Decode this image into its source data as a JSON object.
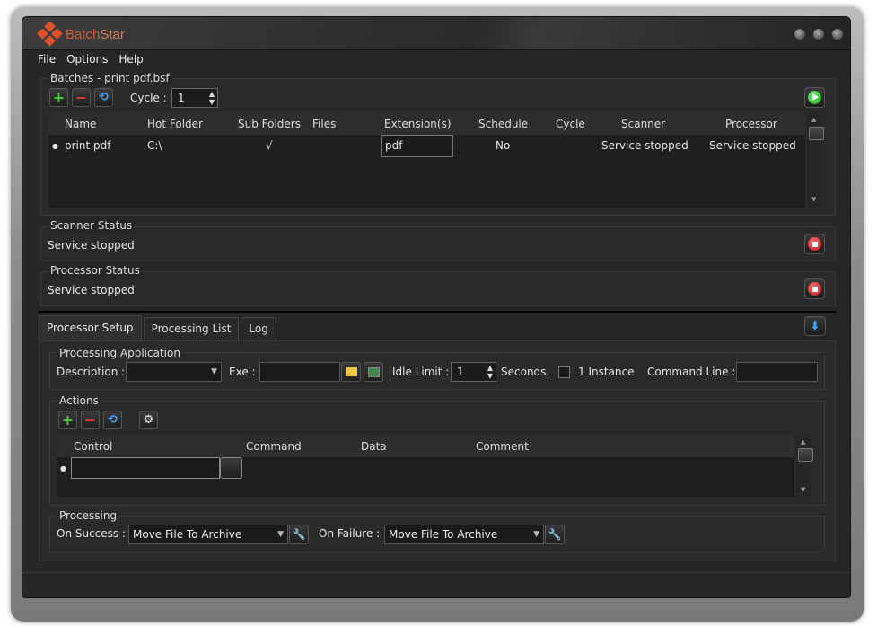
{
  "app": {
    "logo_text_1": "Batch",
    "logo_text_2": "Star"
  },
  "menu": [
    "File",
    "Options",
    "Help"
  ],
  "batches": {
    "title": "Batches  -  print pdf.bsf",
    "cycle_label": "Cycle :",
    "cycle_value": "1",
    "columns": [
      "Name",
      "Hot Folder",
      "Sub Folders",
      "Files",
      "Extension(s)",
      "Schedule",
      "Cycle",
      "Scanner",
      "Processor"
    ],
    "rows": [
      {
        "marker": "●",
        "name": "print pdf",
        "hot_folder": "C:\\",
        "sub_folders": "√",
        "files": "",
        "extensions": "pdf",
        "schedule": "No",
        "cycle": "",
        "scanner": "Service stopped",
        "processor": "Service stopped"
      }
    ]
  },
  "scanner_status": {
    "title": "Scanner Status",
    "value": "Service stopped"
  },
  "processor_status": {
    "title": "Processor Status",
    "value": "Service stopped"
  },
  "tabs": [
    "Processor Setup",
    "Processing List",
    "Log"
  ],
  "processing_application": {
    "title": "Processing Application",
    "description_label": "Description :",
    "description_value": "",
    "exe_label": "Exe :",
    "exe_value": "",
    "idle_limit_label": "Idle Limit :",
    "idle_limit_value": "1",
    "seconds_label": "Seconds.",
    "instance_label": "1 Instance",
    "command_line_label": "Command Line :",
    "command_line_value": ""
  },
  "actions": {
    "title": "Actions",
    "columns": [
      "Control",
      "Command",
      "Data",
      "Comment"
    ],
    "row_marker": "●"
  },
  "processing": {
    "title": "Processing",
    "on_success_label": "On Success :",
    "on_success_value": "Move File To Archive",
    "on_failure_label": "On Failure :",
    "on_failure_value": "Move File To Archive"
  },
  "icons": {
    "add": "plus-icon",
    "remove": "minus-icon",
    "refresh": "refresh-icon",
    "run": "play-icon",
    "stop": "stop-icon",
    "collapse": "arrow-down-icon",
    "folder": "folder-icon",
    "program": "program-icon",
    "settings": "gear-icon",
    "wrench": "wrench-icon"
  },
  "colors": {
    "accent_green": "#44d233",
    "accent_red": "#e23a3a",
    "accent_blue": "#3ea3ff",
    "logo": "#d9532b"
  }
}
